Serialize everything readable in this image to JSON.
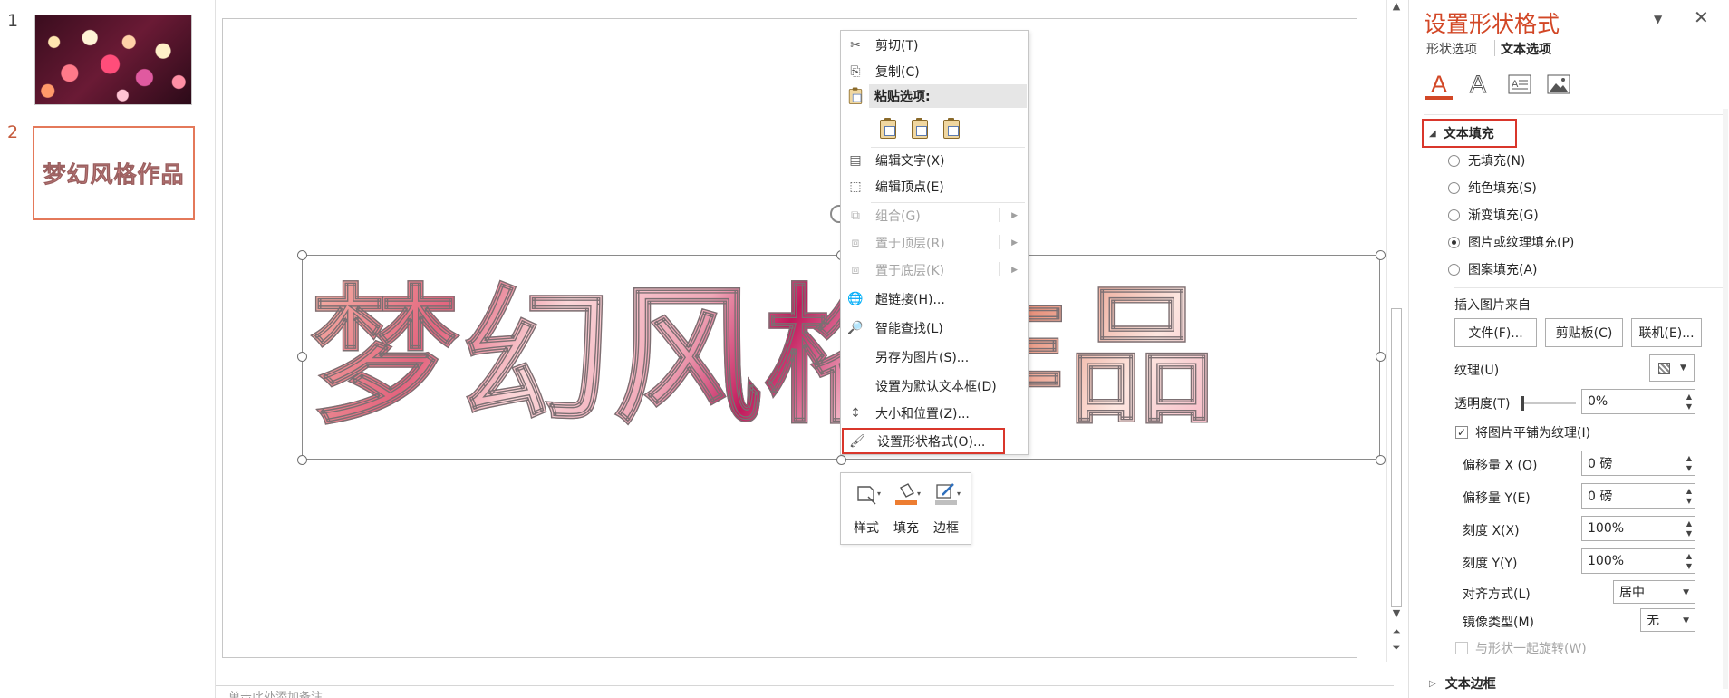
{
  "thumbnails": {
    "slide_numbers": [
      "1",
      "2"
    ],
    "slide2_text": "梦幻风格作品"
  },
  "slide": {
    "title_text": "梦幻风格作品"
  },
  "notes_placeholder": "单击此处添加备注",
  "context_menu": {
    "cut": "剪切(T)",
    "copy": "复制(C)",
    "paste_options": "粘贴选项:",
    "edit_text": "编辑文字(X)",
    "edit_points": "编辑顶点(E)",
    "group": "组合(G)",
    "bring_to_front": "置于顶层(R)",
    "send_to_back": "置于底层(K)",
    "hyperlink": "超链接(H)...",
    "smart_lookup": "智能查找(L)",
    "save_as_picture": "另存为图片(S)...",
    "set_default_textbox": "设置为默认文本框(D)",
    "size_position": "大小和位置(Z)...",
    "format_shape": "设置形状格式(O)..."
  },
  "mini_toolbar": {
    "style": "样式",
    "fill": "填充",
    "outline": "边框",
    "fill_color": "#ed7d31",
    "outline_color": "#bfbfbf"
  },
  "format_pane": {
    "title": "设置形状格式",
    "tab_shape": "形状选项",
    "tab_text": "文本选项",
    "section_fill": "文本填充",
    "radio_none": "无填充(N)",
    "radio_solid": "纯色填充(S)",
    "radio_gradient": "渐变填充(G)",
    "radio_picture": "图片或纹理填充(P)",
    "radio_pattern": "图案填充(A)",
    "insert_from": "插入图片来自",
    "btn_file": "文件(F)...",
    "btn_clipboard": "剪贴板(C)",
    "btn_online": "联机(E)...",
    "texture_label": "纹理(U)",
    "transparency_label": "透明度(T)",
    "transparency_value": "0%",
    "tile_label": "将图片平铺为纹理(I)",
    "offset_x_label": "偏移量 X (O)",
    "offset_x_value": "0 磅",
    "offset_y_label": "偏移量 Y(E)",
    "offset_y_value": "0 磅",
    "scale_x_label": "刻度 X(X)",
    "scale_x_value": "100%",
    "scale_y_label": "刻度 Y(Y)",
    "scale_y_value": "100%",
    "align_label": "对齐方式(L)",
    "align_value": "居中",
    "mirror_label": "镜像类型(M)",
    "mirror_value": "无",
    "rotate_with_shape": "与形状一起旋转(W)",
    "section_outline": "文本边框",
    "accent_color": "#d24726"
  }
}
